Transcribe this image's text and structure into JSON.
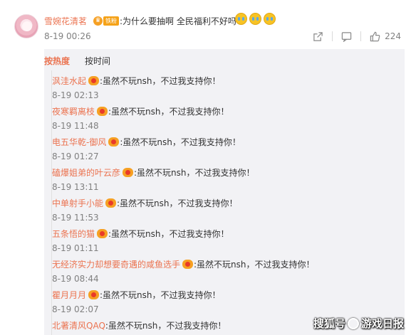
{
  "comment": {
    "author": "雪婉花清茗",
    "fan_tag": "铁粉",
    "text": ":为什么要抽啊 全民福利不好吗",
    "emojis": [
      "crying-face-icon",
      "crying-face-icon",
      "crying-face-icon"
    ],
    "time": "8-19 00:26",
    "like_count": "224"
  },
  "sort_tabs": [
    "按热度",
    "按时间"
  ],
  "replies": [
    {
      "name": "沨洼水起",
      "text": ":虽然不玩nsh，不过我支持你！",
      "time": "8-19 02:13"
    },
    {
      "name": "夜寒羁离枝",
      "text": ":虽然不玩nsh，不过我支持你！",
      "time": "8-19 11:48"
    },
    {
      "name": "电五华乾-御风",
      "text": ":虽然不玩nsh，不过我支持你！",
      "time": "8-19 01:27"
    },
    {
      "name": "磕爆姐弟的叶云彦",
      "text": ":虽然不玩nsh，不过我支持你！",
      "time": "8-19 13:11"
    },
    {
      "name": "中单射手小能",
      "text": ":虽然不玩nsh，不过我支持你！",
      "time": "8-19 11:53"
    },
    {
      "name": "五条悟的猫",
      "text": ":虽然不玩nsh，不过我支持你！",
      "time": "8-19 01:11"
    },
    {
      "name": "无经济实力却想要奇遇的咸鱼选手",
      "text": ":虽然不玩nsh，不过我支持你！",
      "time": "8-19 08:44"
    },
    {
      "name": "瞿月月月",
      "text": ":虽然不玩nsh，不过我支持你！",
      "time": "8-19 02:07"
    },
    {
      "name": "北著清风QAQ",
      "text": ":虽然不玩nsh，不过我支持你！",
      "time": ""
    }
  ],
  "watermark": {
    "prefix": "搜狐号",
    "suffix": "游戏日报"
  },
  "colors": {
    "accent": "#eb7350",
    "reply_bg": "#f2f2f5",
    "muted": "#808080"
  }
}
